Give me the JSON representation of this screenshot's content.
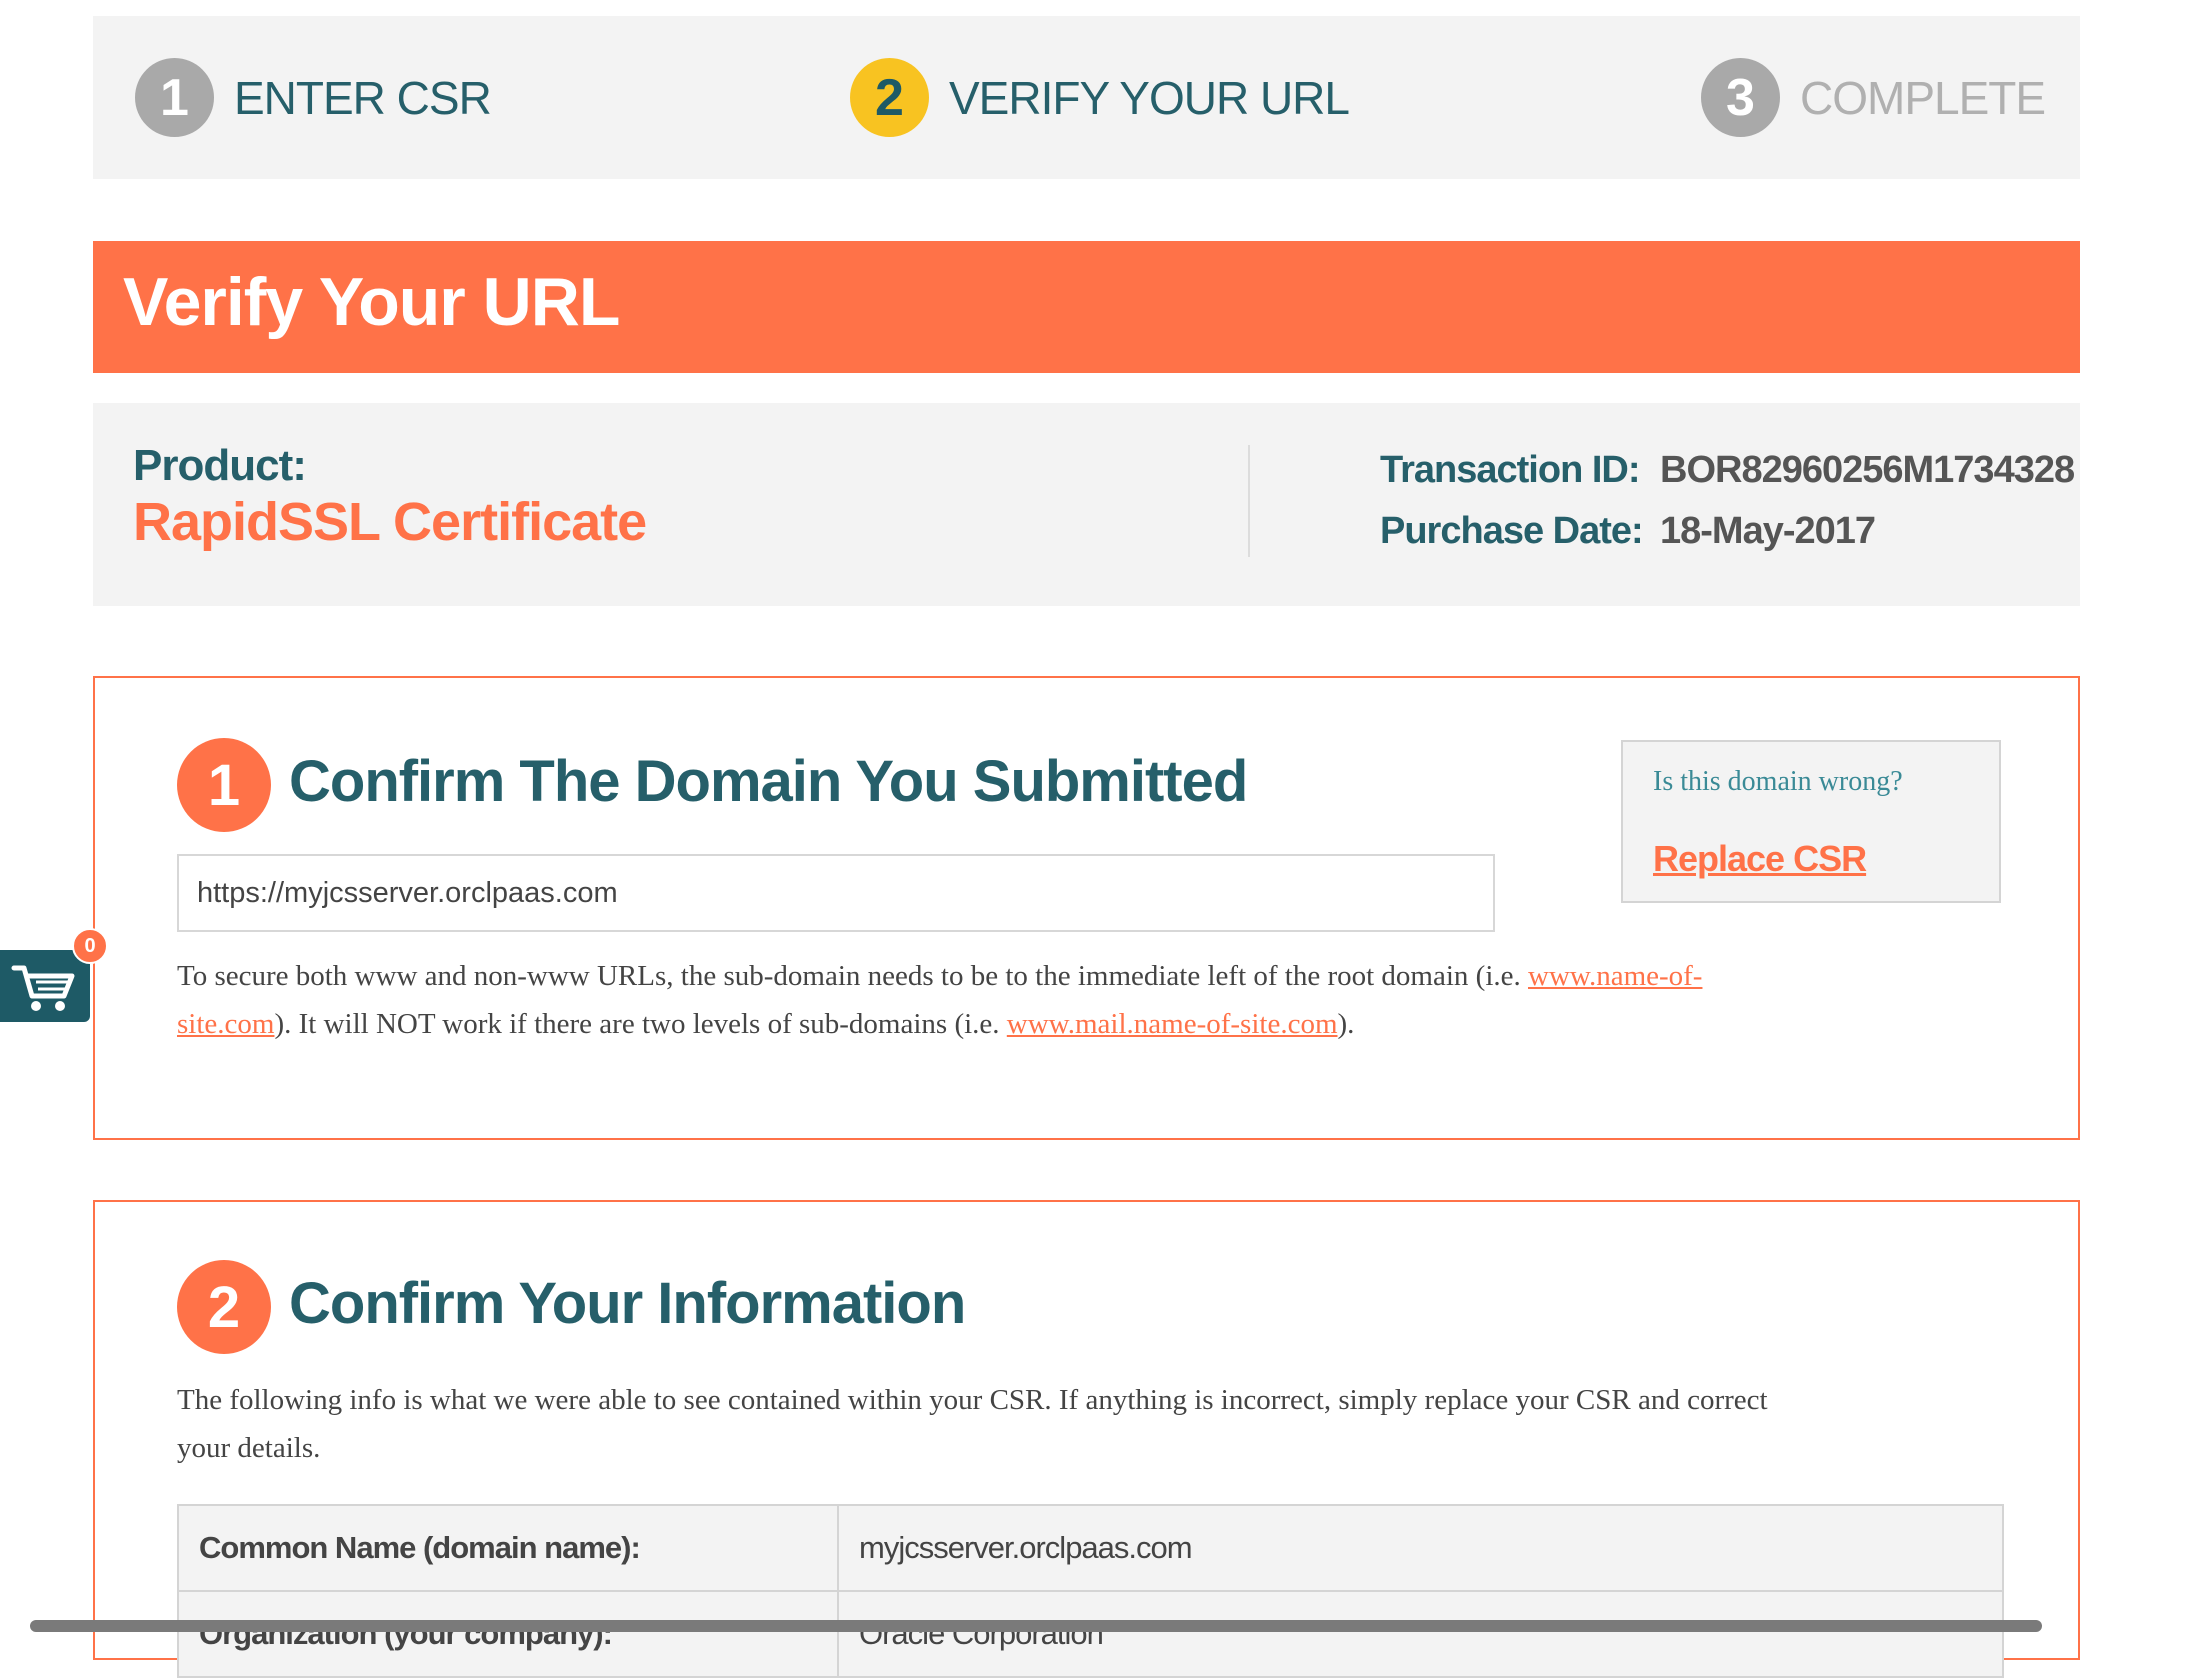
{
  "stepper": {
    "steps": [
      {
        "number": "1",
        "label": "ENTER CSR"
      },
      {
        "number": "2",
        "label": "VERIFY YOUR URL"
      },
      {
        "number": "3",
        "label": "COMPLETE"
      }
    ],
    "active_step": 2,
    "active_color": "#f8c321"
  },
  "page": {
    "title": "Verify Your URL",
    "accent_color": "#ff7248",
    "heading_color": "#265f6a"
  },
  "product": {
    "label": "Product:",
    "name": "RapidSSL Certificate",
    "transaction_label": "Transaction ID:",
    "transaction_id": "BOR82960256M1734328",
    "purchase_label": "Purchase Date:",
    "purchase_date": "18-May-2017"
  },
  "section1": {
    "number": "1",
    "title": "Confirm The Domain You Submitted",
    "domain_value": "https://myjcsserver.orclpaas.com",
    "help_text_1": "To secure both www and non-www URLs, the sub-domain needs to be to the immediate left of the root domain (i.e. ",
    "help_link_1a": "www.name-of-",
    "help_link_1b": "site.com",
    "help_text_2": "). It will NOT work if there are two levels of sub-domains (i.e. ",
    "help_link_2": "www.mail.name-of-site.com",
    "help_text_3": ").",
    "wrong_question": "Is this domain wrong?",
    "replace_link": "Replace CSR"
  },
  "section2": {
    "number": "2",
    "title": "Confirm Your Information",
    "intro_line_1": "The following info is what we were able to see contained within your CSR. If anything is incorrect, simply replace your CSR and correct",
    "intro_line_2": "your details.",
    "rows": [
      {
        "key": "Common Name (domain name):",
        "value": "myjcsserver.orclpaas.com"
      },
      {
        "key": "Organization (your company):",
        "value": "Oracle Corporation"
      }
    ]
  },
  "cart": {
    "icon": "cart-icon",
    "count": "0"
  }
}
